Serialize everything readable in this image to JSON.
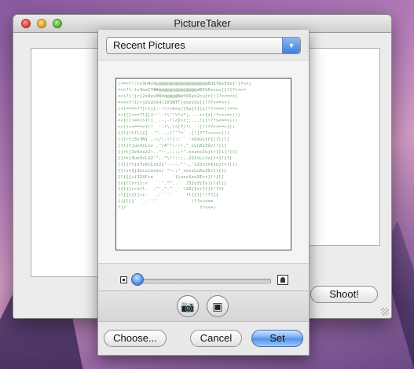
{
  "window": {
    "title": "PictureTaker",
    "shoot_label": "Shoot!"
  },
  "picker": {
    "source_selected": "Recent Pictures",
    "ascii_preview": [
      "(<=>?!:lv3n4zXp@@@@@@@@@@@@@@@@@@8dSf&x93v{!]?<<(",
      "=>>?l:lv3noCT##@@@@@@@@@@@@@@d85%5xcuv[{l]?><>=",
      "<<(?]!jrj2x4yv08dq@@@@Np%S5yo2cujr[!]?<<=<<)",
      "=<<<?!l[rj2n2oS4]1VSNTT[oxzz1v[{!??<<=<<)",
      "(<)===>??[rtj[,-!\\!<h<v/[%ujt]]i]!?<<=>))==<",
      "=<{(]>==?l{[{~`'-!\\\"!\\*v*;,...rr{i]!?><<=>)))",
      "<<[(()==)>?!]_ ,-,-!(<I>r;;...!i]!??><==>)))",
      ">>))<<===>?!!  ':!\\;\\<[7/!!_ -]!!??><==>)))",
      "[[l{(lll[{[  '^...;(^`^<` .[!]???<<<<>)))",
      "({lrtj3z3N} ,-\\/;-!!/:;`` 'nXzujtr1[]l(l[",
      "[{l}tjuzXcLsv ,\"/A^!\\-!!,^_cLnXz3Iv]!{l[",
      "[]rtj3zXnsz2~..\"~-,;;:;~^.nxzncJujtr][i]!{l[",
      "[]rtj3uzXcL22`^,.^\\!!::;,.222sLcJzjtr]!{l[",
      "[{ljrtjz3zXcLsz22'----,\"'-,'x22xznXzujtv][l(",
      "{]rvtIj3zcccnxsx/ ^~:;^_xxsxLnXz3Iv]l{l[",
      "{l{{{i)32XCcn ` `   `(LnccXzu3Ivr]!!{l[",
      "[{{l]rrj]:<   ``'.^^..`  J32z3jIv)]l{l[[",
      "{{l]}rrvrl   .^'.^.^`_  <33jIvr]l]l!??}",
      "\\l{{{{l]rr.   .:``'`     !l{{l]!!??}}",
      "[{{l]}`  _-'''`            !??><<==",
      "?]?`                          ??<<=)"
    ]
  },
  "buttons": {
    "choose": "Choose...",
    "cancel": "Cancel",
    "set": "Set"
  },
  "icons": {
    "popup_arrow": "chevron-down-icon",
    "zoom_out": "small-image-icon",
    "zoom_in": "large-image-icon",
    "camera": "camera-icon",
    "effects": "effects-icon"
  },
  "colors": {
    "default_button": "#4f91e8",
    "ascii_text": "#6aa06a"
  }
}
